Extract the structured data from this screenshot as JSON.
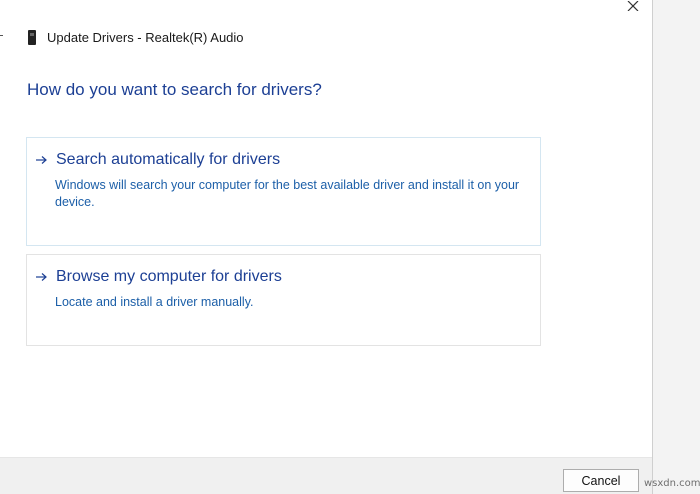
{
  "window": {
    "title": "Update Drivers - Realtek(R) Audio",
    "title_icon": "device-icon",
    "close_icon": "close-icon"
  },
  "main": {
    "heading": "How do you want to search for drivers?",
    "options": [
      {
        "icon": "arrow-right-icon",
        "title": "Search automatically for drivers",
        "description": "Windows will search your computer for the best available driver and install it on your device."
      },
      {
        "icon": "arrow-right-icon",
        "title": "Browse my computer for drivers",
        "description": "Locate and install a driver manually."
      }
    ]
  },
  "footer": {
    "cancel_label": "Cancel"
  },
  "watermark": {
    "text": "wsxdn.com"
  },
  "colors": {
    "heading": "#1c3f94",
    "description": "#1c5fa8",
    "first_option_border": "#d4e6f1",
    "footer_background": "#f0f0f0"
  }
}
